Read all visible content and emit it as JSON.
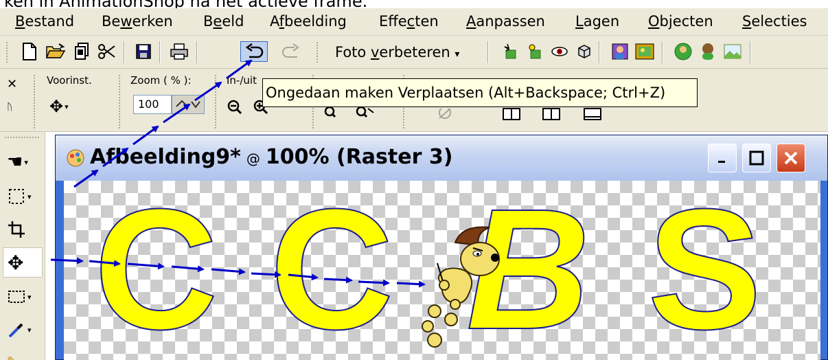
{
  "caption": "ken in AnimationShop na het actieve frame.",
  "menu": [
    {
      "before": "",
      "mnemonic": "B",
      "after": "estand"
    },
    {
      "before": "Be",
      "mnemonic": "w",
      "after": "erken"
    },
    {
      "before": "B",
      "mnemonic": "e",
      "after": "eld"
    },
    {
      "before": "A",
      "mnemonic": "f",
      "after": "beelding"
    },
    {
      "before": "Effe",
      "mnemonic": "c",
      "after": "ten"
    },
    {
      "before": "",
      "mnemonic": "A",
      "after": "anpassen"
    },
    {
      "before": "",
      "mnemonic": "L",
      "after": "agen"
    },
    {
      "before": "",
      "mnemonic": "O",
      "after": "bjecten"
    },
    {
      "before": "",
      "mnemonic": "S",
      "after": "electies"
    }
  ],
  "toolbar": {
    "foto_before": "Foto ",
    "foto_mnemonic": "v",
    "foto_after": "erbeteren",
    "foto_arrow": "▾"
  },
  "options": {
    "preset_label": "Voorinst.",
    "zoom_label": "Zoom ( % ):",
    "zoom_value": "100",
    "inout_label": "In-/uit"
  },
  "tooltip": "Ongedaan maken Verplaatsen (Alt+Backspace; Ctrl+Z)",
  "image_window": {
    "name": "Afbeelding9*",
    "at": "@",
    "zoom_layer": "100% (Raster 3)"
  },
  "canvas_letters": [
    "C",
    "C",
    "B",
    "S"
  ],
  "colors": {
    "letter_fill": "#ffff00",
    "letter_outline": "#1c1c8c",
    "annotation_arrow": "#0000c8",
    "tooltip_bg": "#ffffe1",
    "chrome": "#ece9d8"
  }
}
